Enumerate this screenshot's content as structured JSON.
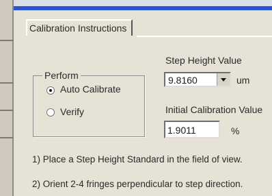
{
  "tab": {
    "label": "Calibration Instructions"
  },
  "perform": {
    "group_label": "Perform",
    "options": [
      {
        "label": "Auto Calibrate",
        "selected": true
      },
      {
        "label": "Verify",
        "selected": false
      }
    ]
  },
  "step_height": {
    "label": "Step Height Value",
    "value": "9.8160",
    "unit": "um"
  },
  "initial_calibration": {
    "label": "Initial Calibration Value",
    "value": "1.9011",
    "unit": "%"
  },
  "instructions": [
    "1) Place a Step Height Standard in the field of view.",
    "2) Orient 2-4 fringes perpendicular to step direction."
  ],
  "colors": {
    "title_bar": "#2a55d0",
    "dialog_bg": "#e6e2d6"
  }
}
